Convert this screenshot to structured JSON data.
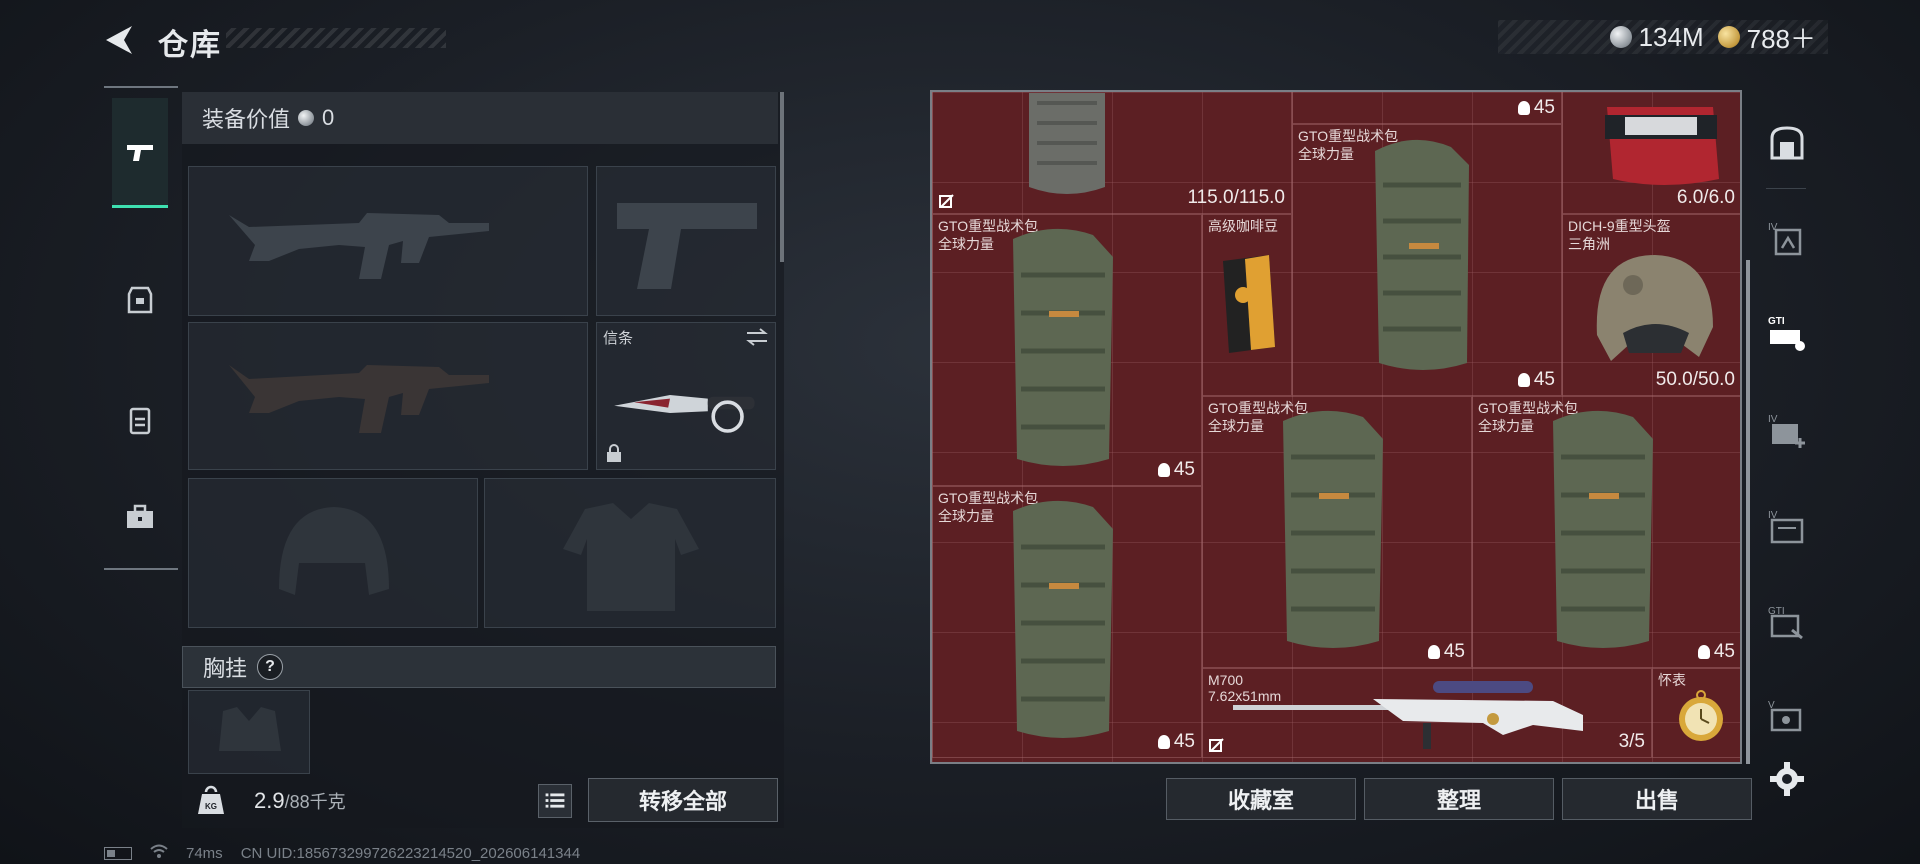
{
  "header": {
    "title": "仓库",
    "currency": [
      {
        "name": "silver",
        "value": "134M"
      },
      {
        "name": "gold",
        "value": "788＋"
      }
    ]
  },
  "equipment": {
    "value_label": "装备价值",
    "value": "0",
    "melee_slot_label": "信条",
    "chest_rig_label": "胸挂",
    "chest_rig_help": "?",
    "weight_current": "2.9",
    "weight_max": "/88千克",
    "transfer_all_label": "转移全部"
  },
  "stash": {
    "items": [
      {
        "name": "",
        "sub": "",
        "value": "115.0/115.0"
      },
      {
        "name": "",
        "sub": "",
        "value": "45"
      },
      {
        "name": "",
        "sub": "",
        "value": "6.0/6.0"
      },
      {
        "name": "GTO重型战术包",
        "sub": "全球力量",
        "value": "45"
      },
      {
        "name": "GTO重型战术包",
        "sub": "全球力量",
        "value": "45"
      },
      {
        "name": "高级咖啡豆",
        "sub": "",
        "value": ""
      },
      {
        "name": "DICH-9重型头盔",
        "sub": "三角洲",
        "value": "50.0/50.0"
      },
      {
        "name": "GTO重型战术包",
        "sub": "全球力量",
        "value": "45"
      },
      {
        "name": "GTO重型战术包",
        "sub": "全球力量",
        "value": "45"
      },
      {
        "name": "GTO重型战术包",
        "sub": "全球力量",
        "value": "45"
      },
      {
        "name": "M700",
        "sub": "7.62x51mm",
        "value": "3/5"
      },
      {
        "name": "怀表",
        "sub": "",
        "value": ""
      }
    ],
    "actions": {
      "collection": "收藏室",
      "sort": "整理",
      "sell": "出售"
    }
  },
  "footer": {
    "ping": "74ms",
    "uid": "CN UID:1856732997262232145​20_202606141344"
  },
  "colors": {
    "accent": "#3ee0b0",
    "stash_bg": "#5c1f23"
  },
  "icons": {
    "back": "chevron-left-icon",
    "side_tabs": [
      "safe-box-icon",
      "iv-backpack-icon",
      "gti-rifle-icon",
      "iv-medkit-icon",
      "iv-folder-icon",
      "gti-hand-icon",
      "v-box-icon",
      "gear-icon"
    ]
  }
}
